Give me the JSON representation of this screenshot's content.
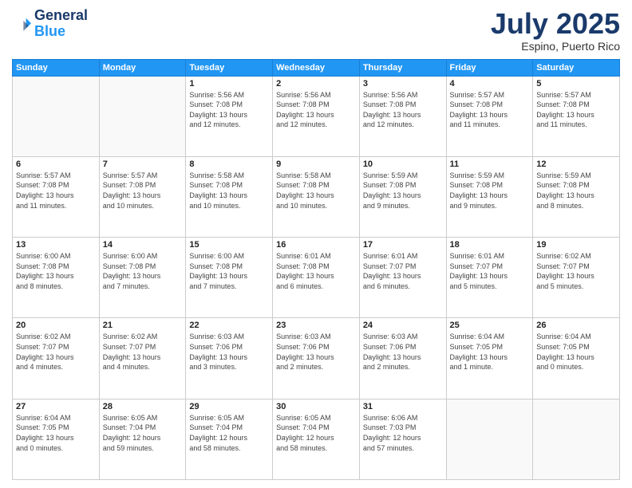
{
  "header": {
    "logo_line1": "General",
    "logo_line2": "Blue",
    "month": "July 2025",
    "location": "Espino, Puerto Rico"
  },
  "weekdays": [
    "Sunday",
    "Monday",
    "Tuesday",
    "Wednesday",
    "Thursday",
    "Friday",
    "Saturday"
  ],
  "weeks": [
    [
      {
        "day": "",
        "info": ""
      },
      {
        "day": "",
        "info": ""
      },
      {
        "day": "1",
        "info": "Sunrise: 5:56 AM\nSunset: 7:08 PM\nDaylight: 13 hours\nand 12 minutes."
      },
      {
        "day": "2",
        "info": "Sunrise: 5:56 AM\nSunset: 7:08 PM\nDaylight: 13 hours\nand 12 minutes."
      },
      {
        "day": "3",
        "info": "Sunrise: 5:56 AM\nSunset: 7:08 PM\nDaylight: 13 hours\nand 12 minutes."
      },
      {
        "day": "4",
        "info": "Sunrise: 5:57 AM\nSunset: 7:08 PM\nDaylight: 13 hours\nand 11 minutes."
      },
      {
        "day": "5",
        "info": "Sunrise: 5:57 AM\nSunset: 7:08 PM\nDaylight: 13 hours\nand 11 minutes."
      }
    ],
    [
      {
        "day": "6",
        "info": "Sunrise: 5:57 AM\nSunset: 7:08 PM\nDaylight: 13 hours\nand 11 minutes."
      },
      {
        "day": "7",
        "info": "Sunrise: 5:57 AM\nSunset: 7:08 PM\nDaylight: 13 hours\nand 10 minutes."
      },
      {
        "day": "8",
        "info": "Sunrise: 5:58 AM\nSunset: 7:08 PM\nDaylight: 13 hours\nand 10 minutes."
      },
      {
        "day": "9",
        "info": "Sunrise: 5:58 AM\nSunset: 7:08 PM\nDaylight: 13 hours\nand 10 minutes."
      },
      {
        "day": "10",
        "info": "Sunrise: 5:59 AM\nSunset: 7:08 PM\nDaylight: 13 hours\nand 9 minutes."
      },
      {
        "day": "11",
        "info": "Sunrise: 5:59 AM\nSunset: 7:08 PM\nDaylight: 13 hours\nand 9 minutes."
      },
      {
        "day": "12",
        "info": "Sunrise: 5:59 AM\nSunset: 7:08 PM\nDaylight: 13 hours\nand 8 minutes."
      }
    ],
    [
      {
        "day": "13",
        "info": "Sunrise: 6:00 AM\nSunset: 7:08 PM\nDaylight: 13 hours\nand 8 minutes."
      },
      {
        "day": "14",
        "info": "Sunrise: 6:00 AM\nSunset: 7:08 PM\nDaylight: 13 hours\nand 7 minutes."
      },
      {
        "day": "15",
        "info": "Sunrise: 6:00 AM\nSunset: 7:08 PM\nDaylight: 13 hours\nand 7 minutes."
      },
      {
        "day": "16",
        "info": "Sunrise: 6:01 AM\nSunset: 7:08 PM\nDaylight: 13 hours\nand 6 minutes."
      },
      {
        "day": "17",
        "info": "Sunrise: 6:01 AM\nSunset: 7:07 PM\nDaylight: 13 hours\nand 6 minutes."
      },
      {
        "day": "18",
        "info": "Sunrise: 6:01 AM\nSunset: 7:07 PM\nDaylight: 13 hours\nand 5 minutes."
      },
      {
        "day": "19",
        "info": "Sunrise: 6:02 AM\nSunset: 7:07 PM\nDaylight: 13 hours\nand 5 minutes."
      }
    ],
    [
      {
        "day": "20",
        "info": "Sunrise: 6:02 AM\nSunset: 7:07 PM\nDaylight: 13 hours\nand 4 minutes."
      },
      {
        "day": "21",
        "info": "Sunrise: 6:02 AM\nSunset: 7:07 PM\nDaylight: 13 hours\nand 4 minutes."
      },
      {
        "day": "22",
        "info": "Sunrise: 6:03 AM\nSunset: 7:06 PM\nDaylight: 13 hours\nand 3 minutes."
      },
      {
        "day": "23",
        "info": "Sunrise: 6:03 AM\nSunset: 7:06 PM\nDaylight: 13 hours\nand 2 minutes."
      },
      {
        "day": "24",
        "info": "Sunrise: 6:03 AM\nSunset: 7:06 PM\nDaylight: 13 hours\nand 2 minutes."
      },
      {
        "day": "25",
        "info": "Sunrise: 6:04 AM\nSunset: 7:05 PM\nDaylight: 13 hours\nand 1 minute."
      },
      {
        "day": "26",
        "info": "Sunrise: 6:04 AM\nSunset: 7:05 PM\nDaylight: 13 hours\nand 0 minutes."
      }
    ],
    [
      {
        "day": "27",
        "info": "Sunrise: 6:04 AM\nSunset: 7:05 PM\nDaylight: 13 hours\nand 0 minutes."
      },
      {
        "day": "28",
        "info": "Sunrise: 6:05 AM\nSunset: 7:04 PM\nDaylight: 12 hours\nand 59 minutes."
      },
      {
        "day": "29",
        "info": "Sunrise: 6:05 AM\nSunset: 7:04 PM\nDaylight: 12 hours\nand 58 minutes."
      },
      {
        "day": "30",
        "info": "Sunrise: 6:05 AM\nSunset: 7:04 PM\nDaylight: 12 hours\nand 58 minutes."
      },
      {
        "day": "31",
        "info": "Sunrise: 6:06 AM\nSunset: 7:03 PM\nDaylight: 12 hours\nand 57 minutes."
      },
      {
        "day": "",
        "info": ""
      },
      {
        "day": "",
        "info": ""
      }
    ]
  ]
}
